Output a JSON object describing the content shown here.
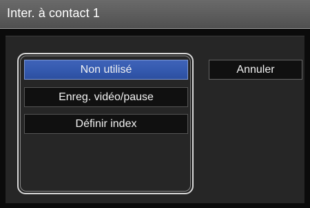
{
  "title": "Inter. à contact 1",
  "options": [
    {
      "label": "Non utilisé",
      "selected": true
    },
    {
      "label": "Enreg. vidéo/pause",
      "selected": false
    },
    {
      "label": "Définir index",
      "selected": false
    }
  ],
  "cancel_label": "Annuler",
  "colors": {
    "selected_bg": "#3358ad",
    "titlebar_bg": "#5c5c5c",
    "panel_bg": "#262626"
  }
}
